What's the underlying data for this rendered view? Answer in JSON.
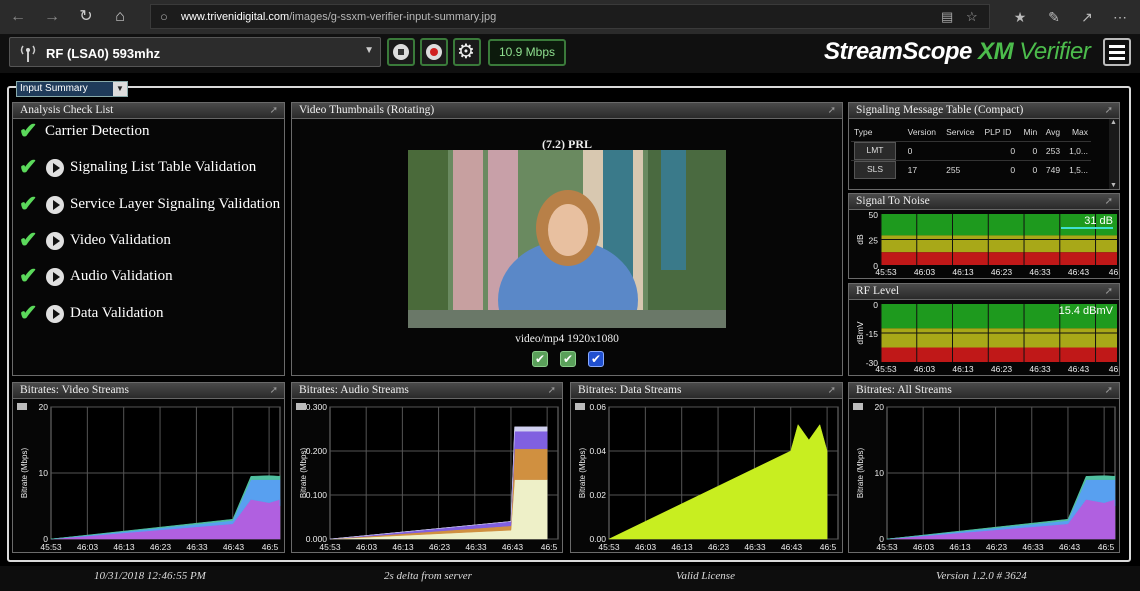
{
  "browser": {
    "url_host": "www.trivenidigital.com",
    "url_path": "/images/g-ssxm-verifier-input-summary.jpg"
  },
  "toolbar": {
    "source": "RF (LSA0) 593mhz",
    "bitrate": "10.9 Mbps",
    "logo_main": "StreamScope",
    "logo_xm": "XM",
    "logo_verifier": "Verifier"
  },
  "view_selector": "Input Summary",
  "check_list": {
    "title": "Analysis Check List",
    "items": [
      {
        "label": "Carrier Detection",
        "has_play": false
      },
      {
        "label": "Signaling List Table Validation",
        "has_play": true
      },
      {
        "label": "Service Layer Signaling Validation",
        "has_play": true
      },
      {
        "label": "Video Validation",
        "has_play": true
      },
      {
        "label": "Audio Validation",
        "has_play": true
      },
      {
        "label": "Data Validation",
        "has_play": true
      }
    ]
  },
  "thumbnails": {
    "title": "Video Thumbnails (Rotating)",
    "channel": "(7.2) PRL",
    "format": "video/mp4 1920x1080"
  },
  "signaling": {
    "title": "Signaling Message Table (Compact)",
    "columns": [
      "Type",
      "Version",
      "Service",
      "PLP ID",
      "Min",
      "Avg",
      "Max"
    ],
    "rows": [
      [
        "LMT",
        "0",
        "",
        "0",
        "0",
        "253",
        "1,0..."
      ],
      [
        "SLS",
        "17",
        "255",
        "0",
        "0",
        "749",
        "1,5..."
      ]
    ]
  },
  "snr": {
    "title": "Signal To Noise",
    "value": "31 dB",
    "unit": "dB",
    "yticks": [
      "50",
      "25",
      "0"
    ],
    "xticks": [
      "45:53",
      "46:03",
      "46:13",
      "46:23",
      "46:33",
      "46:43",
      "46:5"
    ]
  },
  "rf": {
    "title": "RF Level",
    "value": "15.4 dBmV",
    "unit": "dBmV",
    "yticks": [
      "0",
      "-15",
      "-30"
    ],
    "xticks": [
      "45:53",
      "46:03",
      "46:13",
      "46:23",
      "46:33",
      "46:43",
      "46:5"
    ]
  },
  "footer": {
    "datetime": "10/31/2018 12:46:55 PM",
    "delta": "2s delta from server",
    "license": "Valid License",
    "version": "Version 1.2.0 # 3624"
  },
  "colors": {
    "accent": "#4cbc4c",
    "ok": "#5bd95b"
  },
  "chart_data": [
    {
      "type": "area",
      "title": "Bitrates: Video Streams",
      "ylabel": "Bitrate (Mbps)",
      "ylim": [
        0,
        20
      ],
      "yticks": [
        "20",
        "10",
        "0"
      ],
      "xticks": [
        "45:53",
        "46:03",
        "46:13",
        "46:23",
        "46:33",
        "46:43",
        "46:5"
      ],
      "x": [
        0,
        50,
        55,
        60,
        65,
        70
      ],
      "series": [
        {
          "color": "#b060e0",
          "values": [
            0,
            2.3,
            6,
            5.5,
            6,
            5
          ]
        },
        {
          "color": "#58a0f0",
          "values": [
            0,
            0.5,
            3,
            3.5,
            3,
            4
          ]
        },
        {
          "color": "#50c0a0",
          "values": [
            0,
            0.2,
            0.5,
            0.6,
            0.5,
            0.6
          ]
        }
      ]
    },
    {
      "type": "area",
      "title": "Bitrates: Audio Streams",
      "ylabel": "Bitrate (Mbps)",
      "ylim": [
        0,
        0.3
      ],
      "yticks": [
        "0.300",
        "0.200",
        "0.100",
        "0.000"
      ],
      "xticks": [
        "45:53",
        "46:03",
        "46:13",
        "46:23",
        "46:33",
        "46:43",
        "46:5"
      ],
      "x": [
        0,
        50,
        51,
        60
      ],
      "series": [
        {
          "color": "#eef0c8",
          "values": [
            0,
            0.02,
            0.135,
            0.135
          ]
        },
        {
          "color": "#d09040",
          "values": [
            0,
            0.01,
            0.07,
            0.07
          ]
        },
        {
          "color": "#8060e0",
          "values": [
            0,
            0.01,
            0.04,
            0.04
          ]
        },
        {
          "color": "#d0d0f0",
          "values": [
            0,
            0,
            0.01,
            0.01
          ]
        }
      ]
    },
    {
      "type": "area",
      "title": "Bitrates: Data Streams",
      "ylabel": "Bitrate (Mbps)",
      "ylim": [
        0,
        0.06
      ],
      "yticks": [
        "0.06",
        "0.04",
        "0.02",
        "0.00"
      ],
      "xticks": [
        "45:53",
        "46:03",
        "46:13",
        "46:23",
        "46:33",
        "46:43",
        "46:5"
      ],
      "x": [
        0,
        50,
        52,
        55,
        58,
        60
      ],
      "series": [
        {
          "color": "#c8ee20",
          "values": [
            0,
            0.04,
            0.052,
            0.045,
            0.052,
            0.04
          ]
        }
      ]
    },
    {
      "type": "area",
      "title": "Bitrates: All Streams",
      "ylabel": "Bitrate (Mbps)",
      "ylim": [
        0,
        20
      ],
      "yticks": [
        "20",
        "10",
        "0"
      ],
      "xticks": [
        "45:53",
        "46:03",
        "46:13",
        "46:23",
        "46:33",
        "46:43",
        "46:5"
      ],
      "x": [
        0,
        50,
        55,
        60,
        65,
        70
      ],
      "series": [
        {
          "color": "#b060e0",
          "values": [
            0,
            2.3,
            6,
            5.5,
            6,
            5
          ]
        },
        {
          "color": "#58a0f0",
          "values": [
            0,
            0.5,
            3,
            3.5,
            3,
            4
          ]
        },
        {
          "color": "#50c0a0",
          "values": [
            0,
            0.2,
            0.5,
            0.6,
            0.5,
            0.6
          ]
        }
      ]
    }
  ]
}
